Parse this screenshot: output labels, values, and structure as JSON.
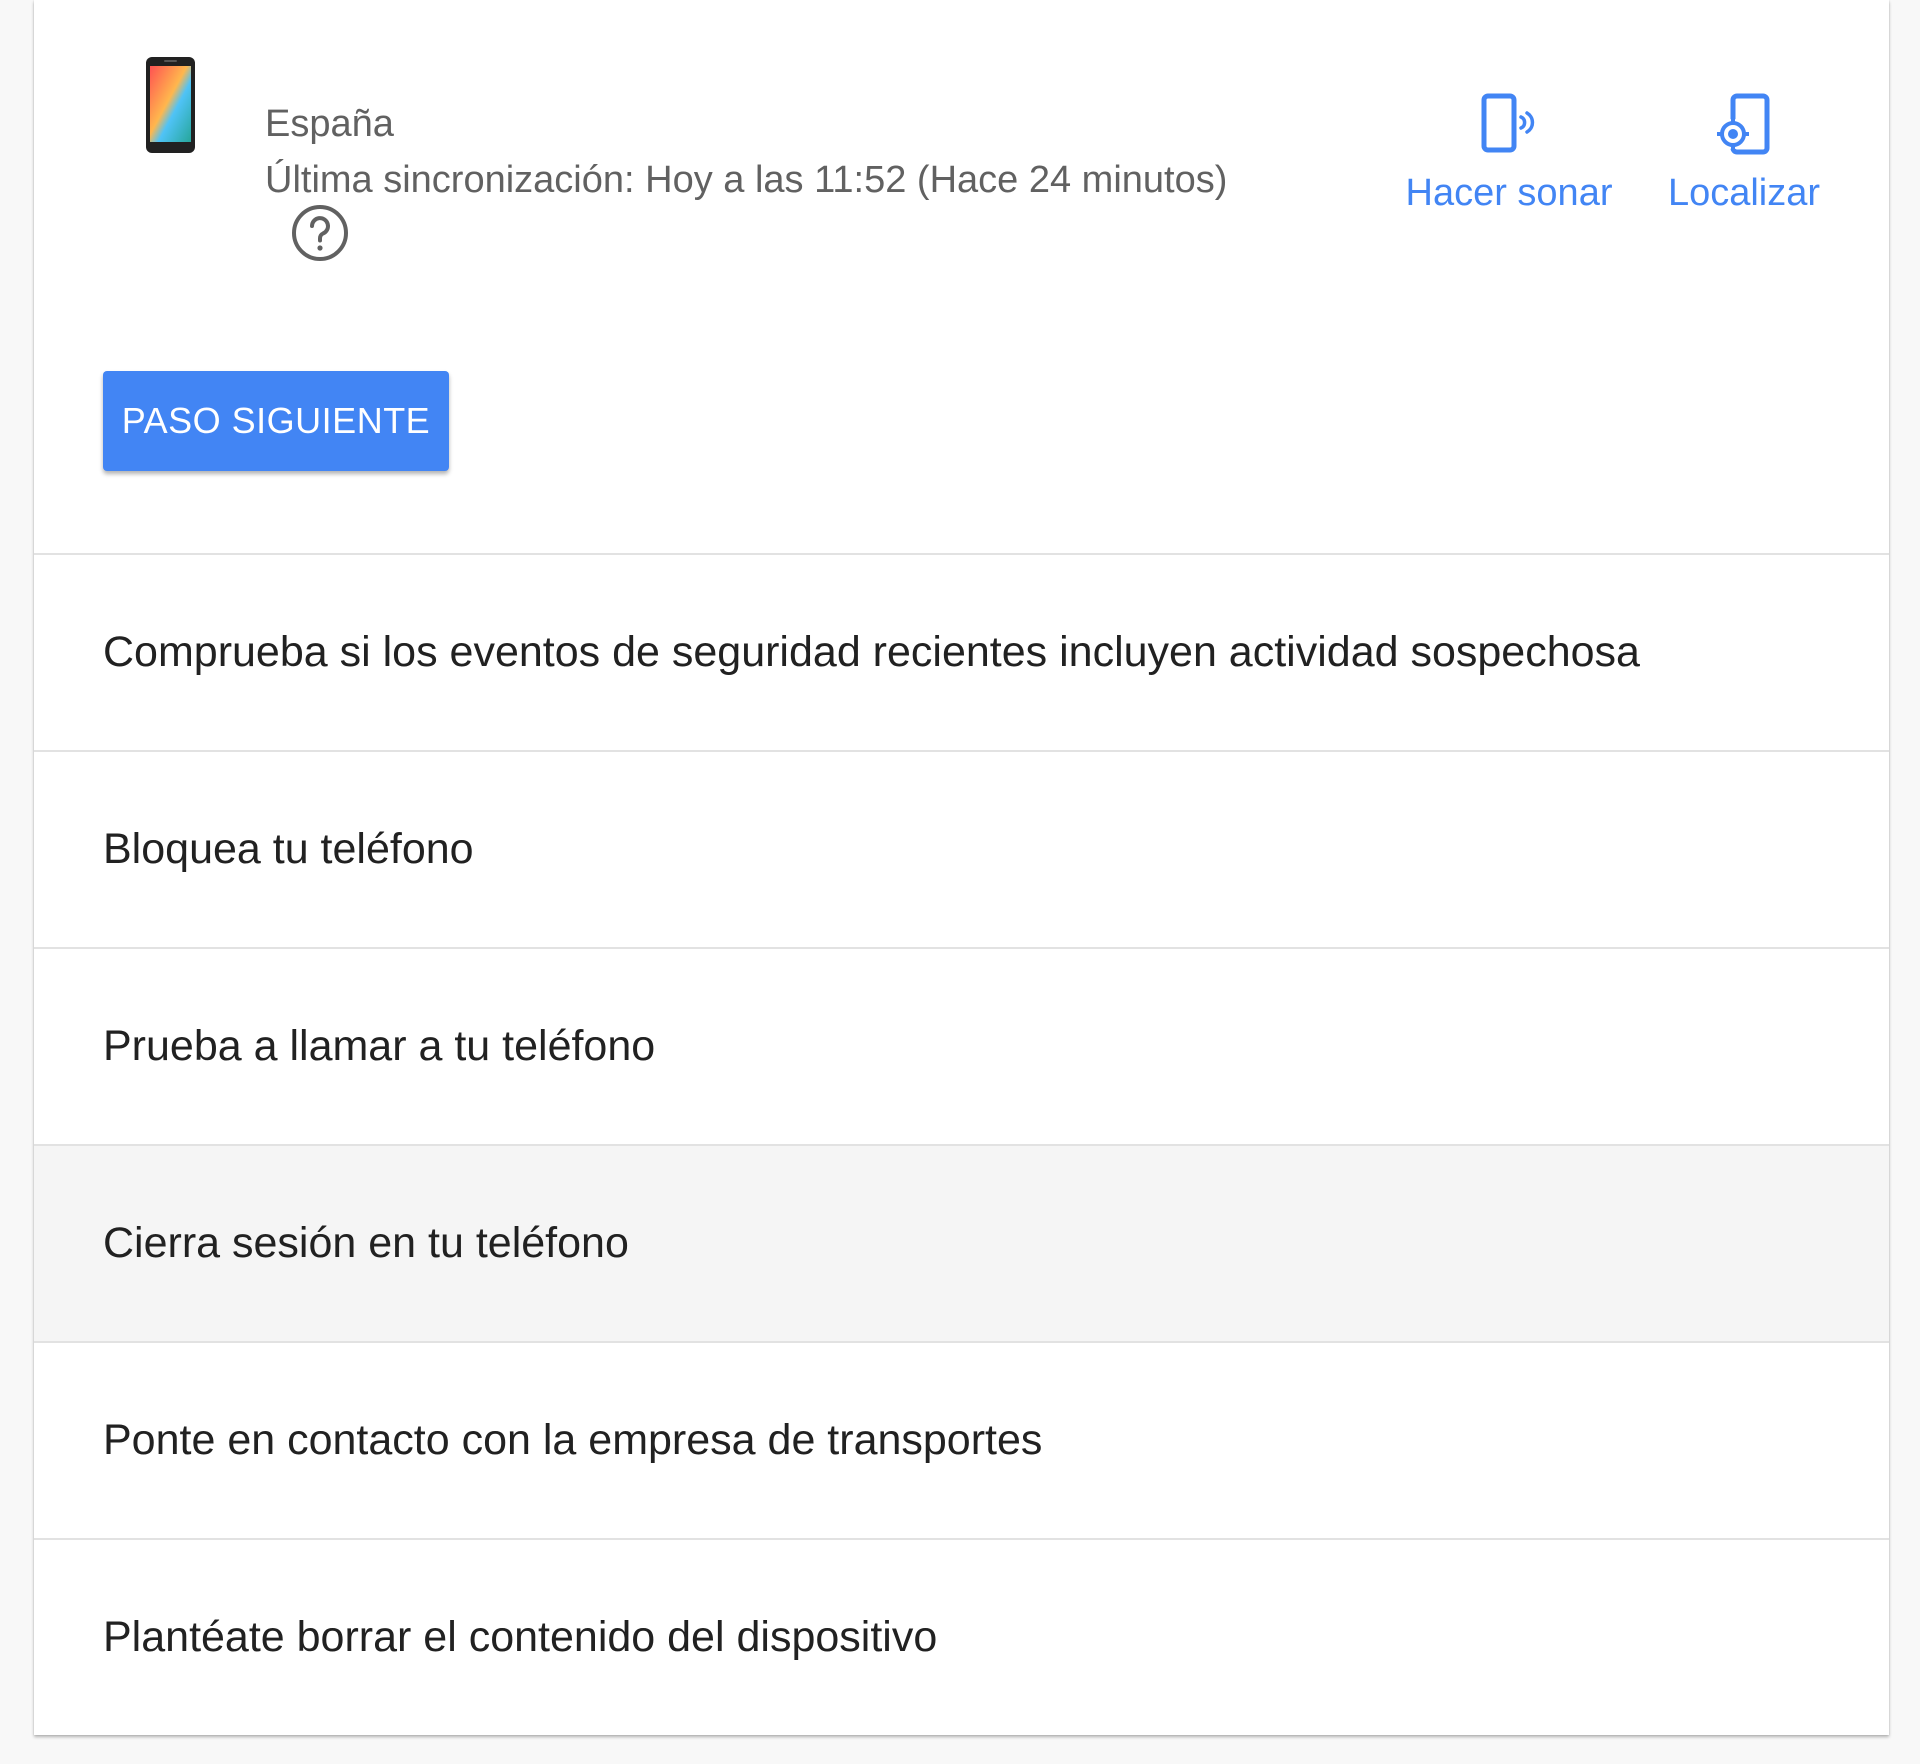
{
  "device": {
    "location": "España",
    "last_sync": "Última sincronización: Hoy a las 11:52 (Hace 24 minutos)"
  },
  "actions": {
    "ring_label": "Hacer sonar",
    "locate_label": "Localizar"
  },
  "next_step_label": "PASO SIGUIENTE",
  "steps": [
    {
      "label": "Comprueba si los eventos de seguridad recientes incluyen actividad sospechosa"
    },
    {
      "label": "Bloquea tu teléfono"
    },
    {
      "label": "Prueba a llamar a tu teléfono"
    },
    {
      "label": "Cierra sesión en tu teléfono",
      "highlighted": true
    },
    {
      "label": "Ponte en contacto con la empresa de transportes"
    },
    {
      "label": "Plantéate borrar el contenido del dispositivo"
    }
  ],
  "colors": {
    "accent": "#4285f4",
    "text_primary": "#212121",
    "text_secondary": "#616161",
    "divider": "#e2e2e2",
    "row_highlight": "#f5f5f5"
  },
  "icons": [
    "phone-device-icon",
    "help-icon",
    "ring-phone-icon",
    "locate-phone-icon"
  ]
}
